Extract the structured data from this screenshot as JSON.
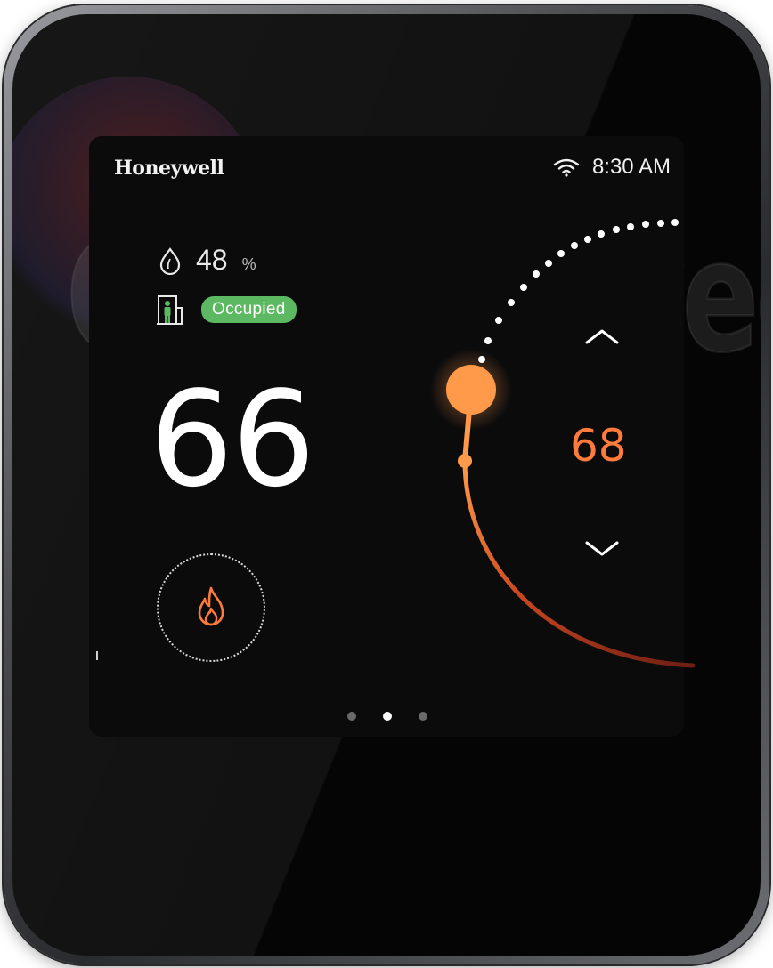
{
  "brand": "Honeywell",
  "watermark": "Climaproyects",
  "status": {
    "time": "8:30 AM",
    "wifi_icon": "wifi-icon"
  },
  "humidity": {
    "value": "48",
    "unit": "%",
    "icon": "water-drop-icon"
  },
  "occupancy": {
    "label": "Occupied",
    "icon": "building-person-icon",
    "badge_color": "#5cb861"
  },
  "current_temperature": "66",
  "setpoint": {
    "value": "68",
    "color": "#ff7a3d",
    "up_icon": "chevron-up-icon",
    "down_icon": "chevron-down-icon"
  },
  "mode": {
    "icon": "flame-icon",
    "color": "#ff7a3d"
  },
  "pager": {
    "count": 3,
    "active_index": 1
  },
  "colors": {
    "screen_bg": "#0b0b0c",
    "accent_orange": "#ff9a4a",
    "arc_dark_red": "#8a2a1a",
    "text": "#ffffff"
  }
}
